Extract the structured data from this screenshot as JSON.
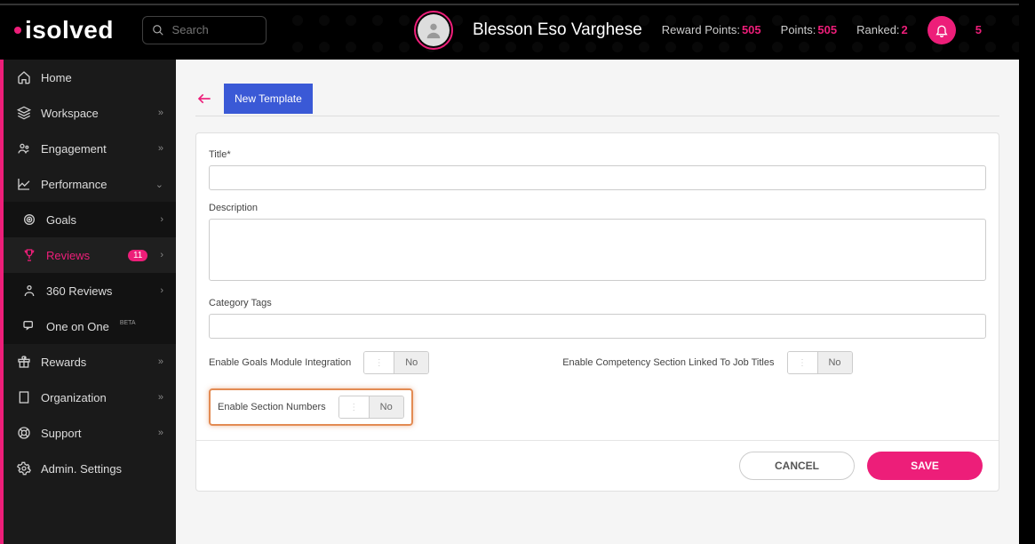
{
  "brand": "isolved",
  "search": {
    "placeholder": "Search"
  },
  "user": {
    "name": "Blesson Eso Varghese",
    "reward_points_label": "Reward Points:",
    "reward_points_value": "505",
    "points_label": "Points:",
    "points_value": "505",
    "ranked_label": "Ranked:",
    "ranked_value": "2",
    "notif_count": "5"
  },
  "sidebar": {
    "home": "Home",
    "workspace": "Workspace",
    "engagement": "Engagement",
    "performance": "Performance",
    "goals": "Goals",
    "reviews": "Reviews",
    "reviews_badge": "11",
    "reviews360": "360 Reviews",
    "one_on_one": "One on One",
    "one_on_one_beta": "BETA",
    "rewards": "Rewards",
    "organization": "Organization",
    "support": "Support",
    "admin": "Admin. Settings"
  },
  "page": {
    "tab_new_template": "New Template"
  },
  "form": {
    "title_label": "Title*",
    "description_label": "Description",
    "category_tags_label": "Category Tags",
    "enable_goals_label": "Enable Goals Module Integration",
    "enable_competency_label": "Enable Competency Section Linked To Job Titles",
    "enable_section_numbers_label": "Enable Section Numbers",
    "toggle_no": "No",
    "cancel": "CANCEL",
    "save": "SAVE"
  }
}
